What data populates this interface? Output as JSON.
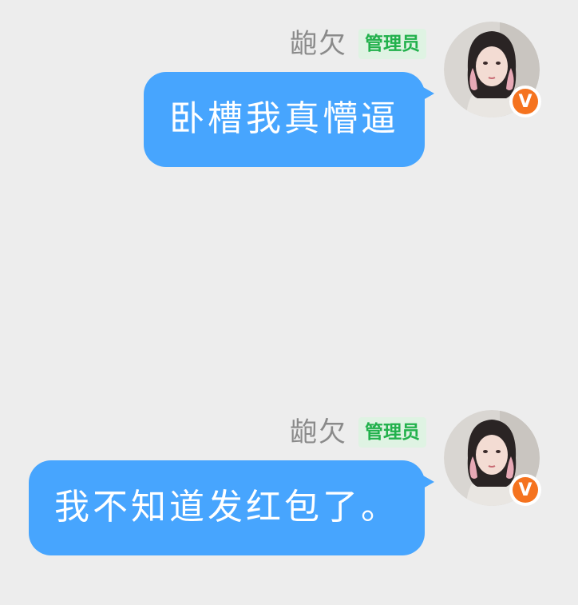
{
  "messages": [
    {
      "sender": "龅欠",
      "role": "管理员",
      "vip_badge": "V",
      "text": "卧槽我真懵逼",
      "avatar_icon": "user-avatar-photo"
    },
    {
      "sender": "龅欠",
      "role": "管理员",
      "vip_badge": "V",
      "text": "我不知道发红包了。",
      "avatar_icon": "user-avatar-photo"
    }
  ],
  "colors": {
    "background": "#ededed",
    "bubble": "#47a5fe",
    "badge_bg": "#dff3e3",
    "badge_text": "#22b14c",
    "vip": "#f5731f",
    "name": "#8a8a8a"
  }
}
